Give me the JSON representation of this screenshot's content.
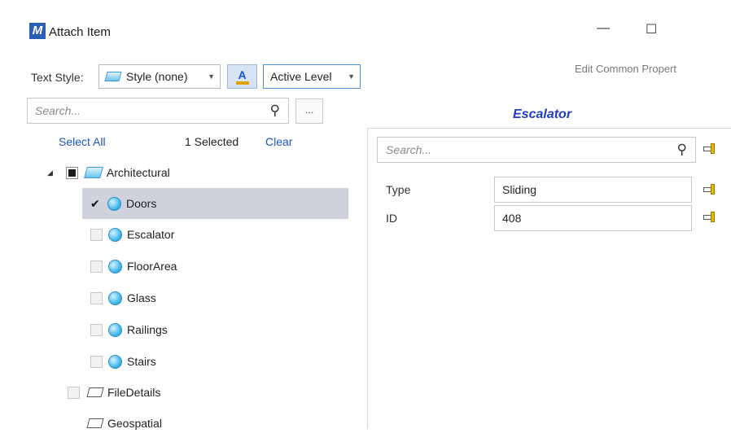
{
  "window": {
    "title": "Attach Item",
    "minimize": "—",
    "maximize": "☐"
  },
  "toolbar": {
    "text_style_label": "Text Style:",
    "style_value": "Style (none)",
    "level_value": "Active Level",
    "hint": "Edit Common Propert"
  },
  "left": {
    "search_placeholder": "Search...",
    "more_label": "...",
    "select_all": "Select All",
    "selected_count": "1 Selected",
    "clear": "Clear",
    "tree": {
      "root": "Architectural",
      "children": [
        "Doors",
        "Escalator",
        "FloorArea",
        "Glass",
        "Railings",
        "Stairs"
      ],
      "others": [
        "FileDetails",
        "Geospatial"
      ]
    }
  },
  "right": {
    "heading": "Escalator",
    "search_placeholder": "Search...",
    "props": [
      {
        "label": "Type",
        "value": "Sliding"
      },
      {
        "label": "ID",
        "value": "408"
      }
    ]
  },
  "colors": {
    "accent": "#1a56c4",
    "selection": "#cfd2dc",
    "heading": "#1f3dbf"
  }
}
